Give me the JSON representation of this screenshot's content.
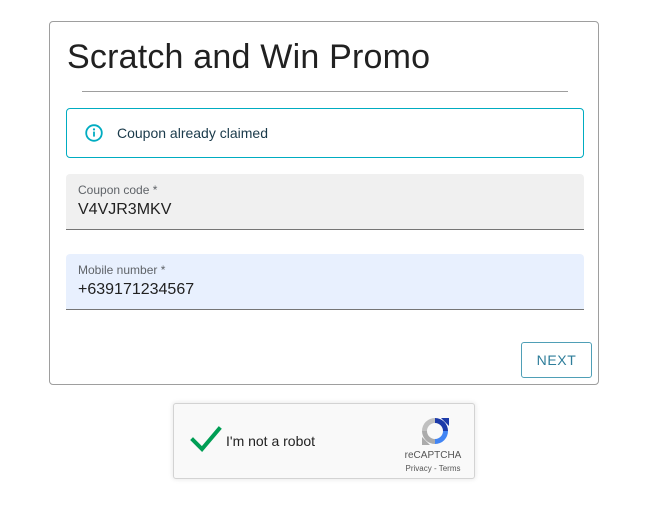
{
  "form": {
    "title": "Scratch and Win Promo",
    "alert": {
      "icon": "info-icon",
      "message": "Coupon already claimed",
      "color": "#00acc1"
    },
    "coupon": {
      "label": "Coupon code *",
      "value": "V4VJR3MKV"
    },
    "mobile": {
      "label": "Mobile number *",
      "value": "+639171234567"
    },
    "next_label": "NEXT"
  },
  "recaptcha": {
    "checked": true,
    "label": "I'm not a robot",
    "brand": "reCAPTCHA",
    "privacy": "Privacy",
    "separator": " - ",
    "terms": "Terms",
    "check_color": "#009e55"
  }
}
